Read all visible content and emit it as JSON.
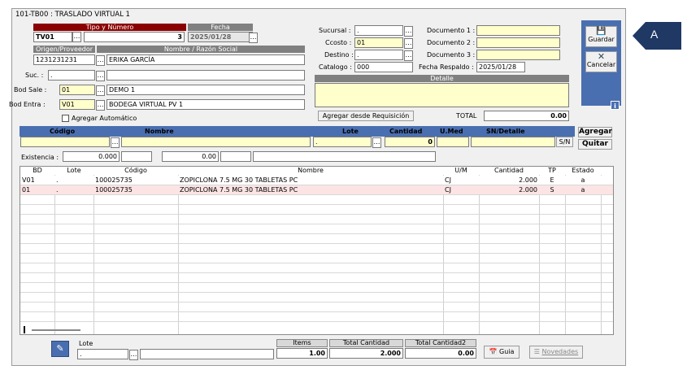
{
  "window": {
    "title": "101-TB00 : TRASLADO VIRTUAL 1"
  },
  "header": {
    "tipo_numero_label": "Tipo y Número",
    "fecha_label": "Fecha",
    "tipo": "TV01",
    "numero": "3",
    "fecha": "2025/01/28",
    "origen_label": "Origen/Proveedor",
    "nombre_label": "Nombre / Razón Social",
    "origen": "1231231231",
    "nombre": "ERIKA GARCÍA",
    "suc_label": "Suc. :",
    "suc": ".",
    "bod_sale_label": "Bod Sale :",
    "bod_sale": "01",
    "bod_sale_name": "DEMO 1",
    "bod_entra_label": "Bod Entra :",
    "bod_entra": "V01",
    "bod_entra_name": "BODEGA VIRTUAL PV 1",
    "agregar_automatico": "Agregar Automático"
  },
  "right": {
    "sucursal_label": "Sucursal :",
    "sucursal": ".",
    "ccosto_label": "Ccosto :",
    "ccosto": "01",
    "destino_label": "Destino :",
    "destino": ".",
    "catalogo_label": "Catalogo :",
    "catalogo": "000",
    "doc1_label": "Documento 1 :",
    "doc2_label": "Documento 2 :",
    "doc3_label": "Documento 3 :",
    "fecha_respaldo_label": "Fecha Respaldo :",
    "fecha_respaldo": "2025/01/28",
    "detalle_label": "Detalle",
    "agregar_req": "Agregar desde Requisición",
    "total_label": "TOTAL",
    "total": "0.00"
  },
  "side": {
    "guardar": "Guardar",
    "cancelar": "Cancelar",
    "info": "i"
  },
  "entry": {
    "codigo_label": "Código",
    "nombre_label": "Nombre",
    "lote_label": "Lote",
    "cantidad_label": "Cantidad",
    "umed_label": "U.Med",
    "sn_label": "SN/Detalle",
    "lote": ".",
    "cantidad": "0",
    "sn_btn": "S/N",
    "agregar": "Agregar",
    "quitar": "Quitar",
    "existencia_label": "Existencia :",
    "existencia1": "0.000",
    "existencia2": "0.00"
  },
  "grid": {
    "columns": [
      "BD",
      "Lote",
      "Código",
      "Nombre",
      "U/M",
      "Cantidad",
      "TP",
      "Estado"
    ],
    "rows": [
      {
        "bd": "V01",
        "lote": ".",
        "codigo": "100025735",
        "nombre": "ZOPICLONA 7.5 MG 30 TABLETAS PC",
        "um": "CJ",
        "cantidad": "2.000",
        "tp": "E",
        "estado": "a"
      },
      {
        "bd": "01",
        "lote": ".",
        "codigo": "100025735",
        "nombre": "ZOPICLONA 7.5 MG 30 TABLETAS PC",
        "um": "CJ",
        "cantidad": "2.000",
        "tp": "S",
        "estado": "a"
      }
    ]
  },
  "footer": {
    "lote_label": "Lote",
    "lote": ".",
    "items_label": "Items",
    "items": "1.00",
    "total_cantidad_label": "Total Cantidad",
    "total_cantidad": "2.000",
    "total_cantidad2_label": "Total Cantidad2",
    "total_cantidad2": "0.00",
    "guia": "Guia",
    "novedades": "Novedades"
  },
  "callout": {
    "label": "A"
  },
  "colors": {
    "header_red": "#8b0000",
    "side_blue": "#4a6fb0",
    "field_yellow": "#ffffcc",
    "row_pink": "#fce4e4"
  }
}
